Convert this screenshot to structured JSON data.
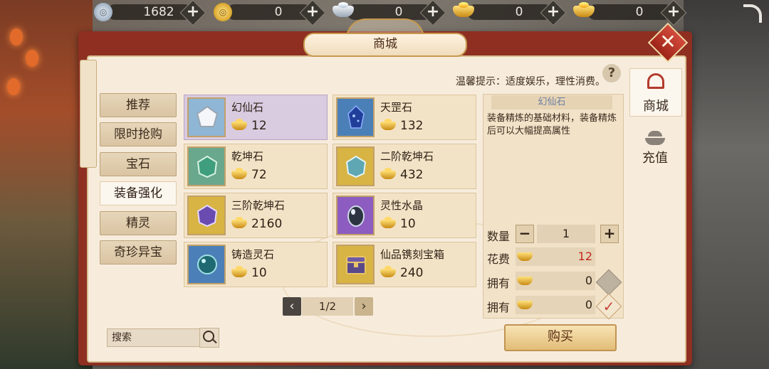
{
  "currency": [
    {
      "value": "1682",
      "icon": "silver-coin-icon"
    },
    {
      "value": "0",
      "icon": "gold-coin-icon"
    },
    {
      "value": "0",
      "icon": "silver-ingot-icon"
    },
    {
      "value": "0",
      "icon": "gold-ingot-icon"
    },
    {
      "value": "0",
      "icon": "gold-ingot-icon"
    }
  ],
  "title": "商城",
  "hint": "温馨提示：适度娱乐，理性消费。",
  "categories": [
    "推荐",
    "限时抢购",
    "宝石",
    "装备强化",
    "精灵",
    "奇珍异宝"
  ],
  "active_category": "装备强化",
  "items": [
    {
      "name": "幻仙石",
      "price": "12",
      "tier": "white",
      "selected": true
    },
    {
      "name": "天罡石",
      "price": "132",
      "tier": "blue"
    },
    {
      "name": "乾坤石",
      "price": "72",
      "tier": "green"
    },
    {
      "name": "二阶乾坤石",
      "price": "432",
      "tier": "yellow"
    },
    {
      "name": "三阶乾坤石",
      "price": "2160",
      "tier": "yellow"
    },
    {
      "name": "灵性水晶",
      "price": "10",
      "tier": "purple"
    },
    {
      "name": "铸造灵石",
      "price": "10",
      "tier": "blue"
    },
    {
      "name": "仙品镌刻宝箱",
      "price": "240",
      "tier": "yellow"
    }
  ],
  "pager": {
    "text": "1/2"
  },
  "search": {
    "placeholder": "搜索"
  },
  "detail": {
    "title": "幻仙石",
    "description": "装备精炼的基础材料，装备精炼后可以大幅提高属性",
    "qty_label": "数量",
    "qty": "1",
    "cost_label": "花费",
    "cost": "12",
    "own_label_1": "拥有",
    "own_1": "0",
    "own_label_2": "拥有",
    "own_2": "0",
    "buy_label": "购买"
  },
  "side_tabs": {
    "shop": "商城",
    "topup": "充值"
  },
  "colors": {
    "frame": "#8e2f22",
    "panel": "#f7ecdc",
    "accent_red": "#c22a1f",
    "gold": "#c98a14"
  }
}
